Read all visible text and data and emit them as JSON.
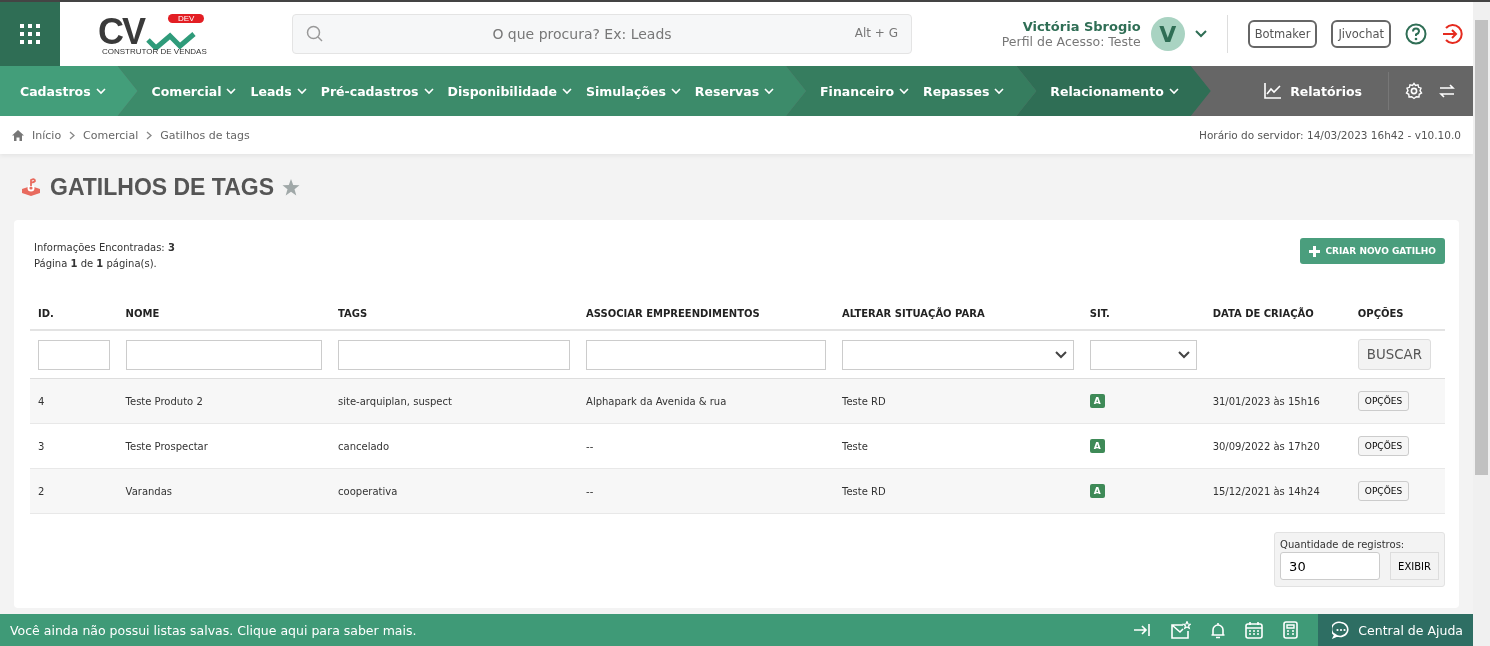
{
  "header": {
    "logo": {
      "letters": "CV",
      "badge": "DEV",
      "tagline": "CONSTRUTOR DE VENDAS"
    },
    "search": {
      "placeholder": "O que procura? Ex: Leads",
      "shortcut": "Alt + G"
    },
    "user": {
      "name": "Victória Sbrogio",
      "profile": "Perfil de Acesso: Teste",
      "initial": "V"
    },
    "buttons": [
      "Botmaker",
      "Jivochat"
    ]
  },
  "nav": {
    "groups": [
      {
        "color": "#439e7a",
        "items": [
          "Cadastros"
        ]
      },
      {
        "color": "#3c8b6a",
        "items": [
          "Comercial",
          "Leads",
          "Pré-cadastros",
          "Disponibilidade",
          "Simulações",
          "Reservas"
        ]
      },
      {
        "color": "#367d5f",
        "items": [
          "Financeiro",
          "Repasses"
        ]
      },
      {
        "color": "#2f6e55",
        "items": [
          "Relacionamento"
        ]
      }
    ],
    "reports": "Relatórios"
  },
  "breadcrumb": [
    "Início",
    "Comercial",
    "Gatilhos de tags"
  ],
  "server_time": "Horário do servidor: 14/03/2023 16h42 - v10.10.0",
  "page_title": "GATILHOS DE TAGS",
  "info": [
    "Informações Encontradas: **3**",
    "Página **1** de **1** página(s)."
  ],
  "create_button": "CRIAR NOVO GATILHO",
  "table": {
    "columns": [
      "ID.",
      "NOME",
      "TAGS",
      "ASSOCIAR EMPREENDIMENTOS",
      "ALTERAR SITUAÇÃO PARA",
      "SIT.",
      "DATA DE CRIAÇÃO",
      "OPÇÕES"
    ],
    "filters": [
      {
        "kind": "text"
      },
      {
        "kind": "text"
      },
      {
        "kind": "text"
      },
      {
        "kind": "text"
      },
      {
        "kind": "select"
      },
      {
        "kind": "select"
      },
      {
        "kind": "empty"
      },
      {
        "kind": "button",
        "label": "BUSCAR"
      }
    ],
    "rows": [
      {
        "cells": [
          "4",
          "Teste Produto 2",
          "site-arquiplan, suspect",
          "Alphapark da Avenida & rua",
          "Teste RD"
        ],
        "status": "A",
        "date": "31/01/2023 às 15h16",
        "action": "OPÇÕES"
      },
      {
        "cells": [
          "3",
          "Teste Prospectar",
          "cancelado",
          "--",
          "Teste"
        ],
        "status": "A",
        "date": "30/09/2022 às 17h20",
        "action": "OPÇÕES"
      },
      {
        "cells": [
          "2",
          "Varandas",
          "cooperativa",
          "--",
          "Teste RD"
        ],
        "status": "A",
        "date": "15/12/2021 às 14h24",
        "action": "OPÇÕES"
      }
    ]
  },
  "records": {
    "label": "Quantidade de registros:",
    "value": "30",
    "button": "EXIBIR"
  },
  "footer": {
    "message": "Você ainda não possui listas salvas. Clique aqui para saber mais.",
    "help": "Central de Ajuda"
  }
}
